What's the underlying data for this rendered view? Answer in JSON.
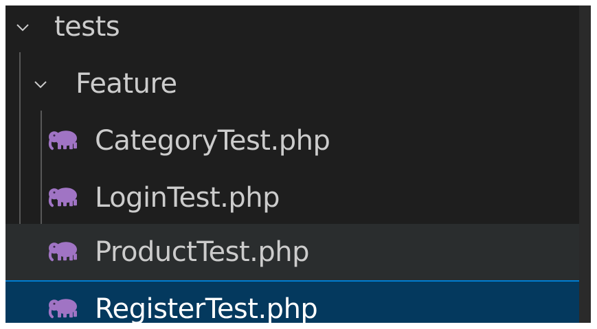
{
  "explorer": {
    "folders": [
      {
        "label": "tests",
        "expanded": true,
        "icon": "chevron-down-icon"
      },
      {
        "label": "Feature",
        "expanded": true,
        "icon": "chevron-down-icon"
      }
    ],
    "files": [
      {
        "label": "CategoryTest.php",
        "icon": "php-elephant-icon",
        "state": "normal"
      },
      {
        "label": "LoginTest.php",
        "icon": "php-elephant-icon",
        "state": "normal"
      },
      {
        "label": "ProductTest.php",
        "icon": "php-elephant-icon",
        "state": "hover"
      },
      {
        "label": "RegisterTest.php",
        "icon": "php-elephant-icon",
        "state": "selected"
      }
    ]
  },
  "colors": {
    "background": "#1e1e1e",
    "text": "#cccccc",
    "hover_row": "#2a2d2e",
    "selected_row": "#04395e",
    "selected_border": "#007fd4",
    "php_icon": "#a074c4",
    "indent_guide": "#585858"
  }
}
